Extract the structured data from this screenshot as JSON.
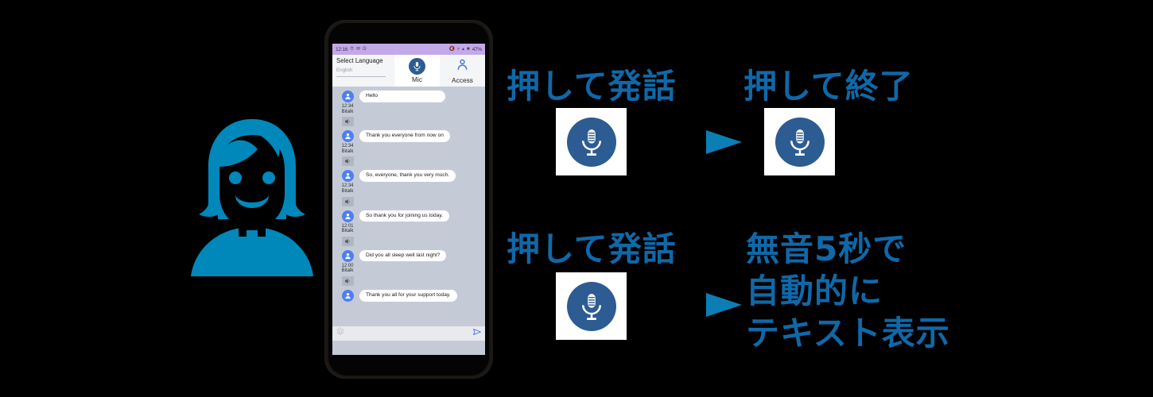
{
  "phone": {
    "status_bar": {
      "time": "12:16",
      "left_icons": [
        "alarm-icon",
        "mail-icon",
        "google-icon"
      ],
      "right_icons": [
        "mute-icon",
        "wifi-icon",
        "signal-icon",
        "battery-icon"
      ],
      "battery": "47%"
    },
    "top_bar": {
      "language_label": "Select Language",
      "language_value": "English",
      "tabs": [
        {
          "label": "Mic",
          "icon": "microphone-icon",
          "active": true
        },
        {
          "label": "Access",
          "icon": "person-icon",
          "active": false
        }
      ]
    },
    "messages": [
      {
        "text": "Hello",
        "time": "12:34",
        "app": "Bitalk",
        "avatar": "person-avatar-icon",
        "speaker": "speaker-icon"
      },
      {
        "text": "Thank you everyone from now on",
        "time": "12:34",
        "app": "Bitalk",
        "avatar": "person-avatar-icon",
        "speaker": "speaker-icon"
      },
      {
        "text": "So, everyone, thank you very much.",
        "time": "12:34",
        "app": "Bitalk",
        "avatar": "person-avatar-icon",
        "speaker": "speaker-icon"
      },
      {
        "text": "So thank you for joining us today.",
        "time": "12:01",
        "app": "Bitalk",
        "avatar": "person-avatar-icon",
        "speaker": "speaker-icon"
      },
      {
        "text": "Did you all sleep well last night?",
        "time": "12:00",
        "app": "Bitalk",
        "avatar": "person-avatar-icon",
        "speaker": "speaker-icon"
      },
      {
        "text": "Thank you all for your support today.",
        "time": "",
        "app": "",
        "avatar": "person-avatar-icon",
        "speaker": ""
      }
    ],
    "input_bar": {
      "settings_icon": "gear-icon",
      "send_icon": "send-arrow-icon",
      "placeholder": ""
    }
  },
  "annotations": {
    "press_to_speak_top": "押して発話",
    "press_to_end": "押して終了",
    "press_to_speak_bottom": "押して発話",
    "auto_text_line1": "無音5秒で",
    "auto_text_line2": "自動的に",
    "auto_text_line3": "テキスト表示"
  },
  "illustration": {
    "woman": "woman-avatar-icon"
  },
  "colors": {
    "accent_text": "#1068a8",
    "woman": "#0088bb",
    "arrow": "#0b7fb5",
    "mic_circle": "#2c5c91",
    "status_bar": "#c3a9e8",
    "chat_background": "#c5cbd6",
    "avatar_blue": "#4d7ff0",
    "background": "#000000"
  }
}
